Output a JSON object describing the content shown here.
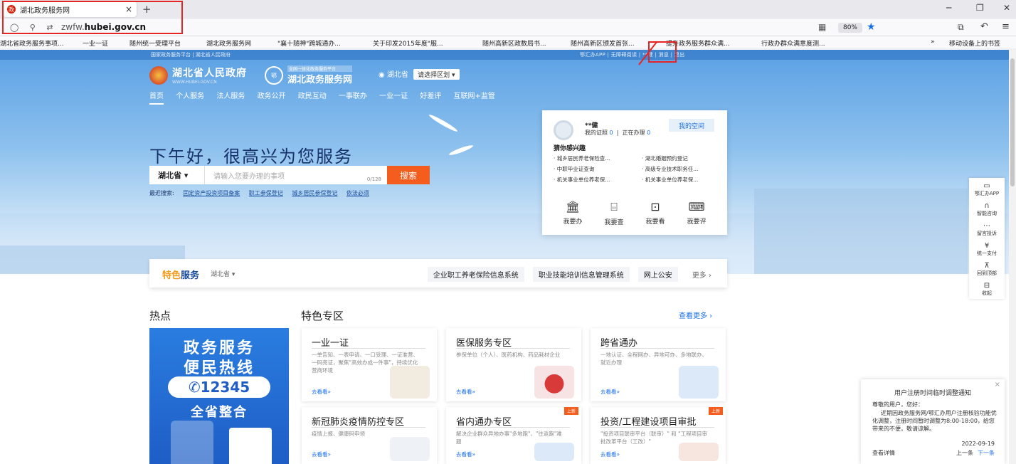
{
  "browser": {
    "tab_title": "湖北政务服务网",
    "tab_close": "×",
    "new_tab": "+",
    "url_prefix": "zwfw.",
    "url_domain": "hubei.gov.cn",
    "zoom": "80%",
    "bookmarks": [
      "湖北省政务服务事项...",
      "一业一证",
      "随州统一受理平台",
      "湖北政务服务网",
      "\"襄十随神\"跨城通办...",
      "关于印发2015年度\"服...",
      "随州高新区政数局书...",
      "随州高新区颁发首张...",
      "提升政务服务群众满...",
      "行政办群众满意度测..."
    ],
    "bookmark_right": "移动设备上的书签",
    "bookmark_more": "»"
  },
  "site": {
    "top_left": "国家政务服务平台 | 湖北省人民政府",
    "top_right": "鄂汇办APP | 无障碍阅读 | **健 | 消息 | 退出",
    "gov_name": "湖北省人民政府",
    "gov_sub": "WWW.HUBEI.GOV.CN",
    "portal_tag": "全国一体化政务服务平台",
    "portal_name": "湖北政务服务网",
    "region": "湖北省",
    "region_btn": "请选择区划",
    "nav": [
      "首页",
      "个人服务",
      "法人服务",
      "政务公开",
      "政民互动",
      "一事联办",
      "一业一证",
      "好差评",
      "互联网+监管"
    ],
    "greeting": "下午好，很高兴为您服务",
    "search_region": "湖北省",
    "search_placeholder": "请输入您要办理的事项",
    "search_count": "0/128",
    "search_button": "搜索",
    "recent_label": "最近搜索:",
    "recent": [
      "固定资产投资项目备案",
      "职工参保登记",
      "城乡居民参保登记",
      "依法必须"
    ]
  },
  "user_card": {
    "name": "**健",
    "license_label": "我的证照",
    "license_count": "0",
    "doing_label": "正在办理",
    "doing_count": "0",
    "space_btn": "我的空间",
    "guess_title": "猜你感兴趣",
    "guess": [
      "城乡居民养老保险查...",
      "湖北婚姻预约登记",
      "中职毕业证查询",
      "高级专业技术职务任...",
      "机关事业单位养老保...",
      "机关事业单位养老保..."
    ],
    "actions": [
      "我要办",
      "我要查",
      "我要看",
      "我要评"
    ]
  },
  "sidebar": [
    "鄂汇办APP",
    "智能咨询",
    "留言投诉",
    "统一支付",
    "回到顶部",
    "收起"
  ],
  "feature": {
    "title_a": "特色",
    "title_b": "服务",
    "province": "湖北省",
    "links": [
      "企业职工养老保险信息系统",
      "职业技能培训信息管理系统",
      "网上公安"
    ],
    "more": "更多"
  },
  "hot": {
    "title": "热点",
    "banner_l1": "政务服务",
    "banner_l2": "便民热线",
    "banner_num": "12345",
    "banner_l3": "全省整合"
  },
  "zones": {
    "title": "特色专区",
    "view_more": "查看更多 ›",
    "cards": [
      {
        "title": "一业一证",
        "desc": "一单告知、一表申请、一口受理、一证准营、一码亮证，聚焦\"高效办成一件事\"，持续优化营商环境",
        "go": "去看看»",
        "new": ""
      },
      {
        "title": "医保服务专区",
        "desc": "参保单位（个人）、医药机构、药品耗材企业",
        "go": "去看看»",
        "new": ""
      },
      {
        "title": "跨省通办",
        "desc": "一地认证、全程网办、异地可办、多地联办、就近办理",
        "go": "去看看»",
        "new": ""
      },
      {
        "title": "新冠肺炎疫情防控专区",
        "desc": "疫情上报、健康码申领",
        "go": "去看看»",
        "new": ""
      },
      {
        "title": "省内通办专区",
        "desc": "解决企业群众异地办事\"多地跑\"、\"往返跑\"难题",
        "go": "去看看»",
        "new": "上新"
      },
      {
        "title": "投资/工程建设项目审批",
        "desc": "\"投资项目联审平台（联审）\" 和 \"工程项目审批改革平台（工改）\"",
        "go": "去看看»",
        "new": "上新"
      }
    ]
  },
  "notice": {
    "title": "用户注册时间临时调整通知",
    "greeting": "尊敬的用户，您好：",
    "body": "近期因政务服务网/鄂汇办用户注册核验功能优化调整，注册时间暂时调整为8:00-18:00，给您带来的不便，敬请谅解。",
    "date": "2022-09-19",
    "detail": "查看详情",
    "prev": "上一条",
    "next": "下一条"
  }
}
